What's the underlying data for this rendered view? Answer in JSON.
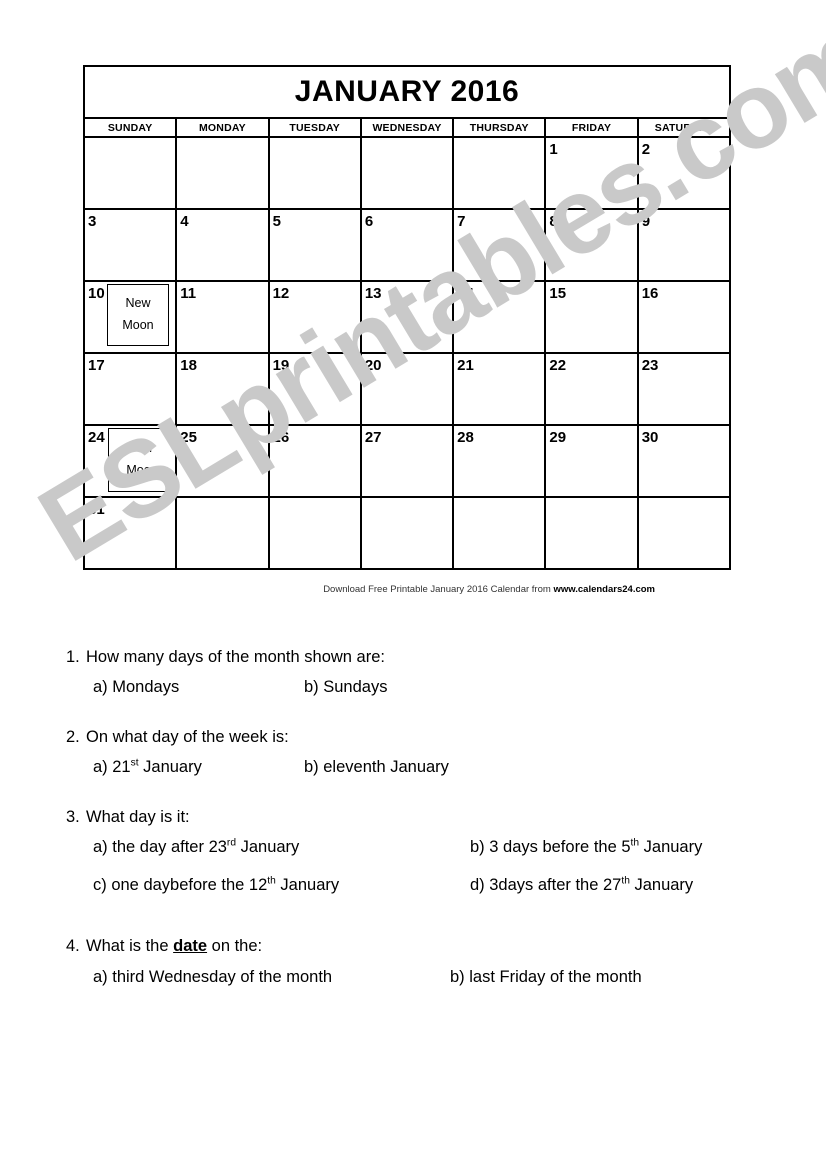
{
  "watermark": {
    "text": "ESLprintables.com"
  },
  "calendar": {
    "title": "JANUARY 2016",
    "weekdays": [
      "SUNDAY",
      "MONDAY",
      "TUESDAY",
      "WEDNESDAY",
      "THURSDAY",
      "FRIDAY",
      "SATURDAY"
    ],
    "weeks": [
      [
        "",
        "",
        "",
        "",
        "",
        "1",
        "2"
      ],
      [
        "3",
        "4",
        "5",
        "6",
        "7",
        "8",
        "9"
      ],
      [
        "10",
        "11",
        "12",
        "13",
        "14",
        "15",
        "16"
      ],
      [
        "17",
        "18",
        "19",
        "20",
        "21",
        "22",
        "23"
      ],
      [
        "24",
        "25",
        "26",
        "27",
        "28",
        "29",
        "30"
      ],
      [
        "31",
        "",
        "",
        "",
        "",
        "",
        ""
      ]
    ],
    "moon_new_line1": "New",
    "moon_new_line2": "Moon",
    "moon_full_line1": "Full",
    "moon_full_line2": "Moon",
    "footer_prefix": "Download  Free Printable January 2016 Calendar from",
    "footer_site": "www.calendars24.com"
  },
  "questions": {
    "q1": {
      "number": "1.",
      "stem": "How many days of the month shown are:",
      "a": "a)  Mondays",
      "b": "b) Sundays"
    },
    "q2": {
      "number": "2.",
      "stem": "On what day of the week is:",
      "a_pre": "a) 21",
      "a_sup": "st",
      "a_post": " January",
      "b": "b) eleventh January"
    },
    "q3": {
      "number": "3.",
      "stem": "What day is it:",
      "a_pre": "a) the day after 23",
      "a_sup": "rd",
      "a_post": " January",
      "b_pre": "b) 3 days before the 5",
      "b_sup": "th",
      "b_post": " January",
      "c_pre": "c) one daybefore the 12",
      "c_sup": "th",
      "c_post": " January",
      "d_pre": "d) 3days after the 27",
      "d_sup": "th",
      "d_post": " January"
    },
    "q4": {
      "number": "4.",
      "stem_pre": "What is the ",
      "stem_em": "date",
      "stem_post": " on the:",
      "a": "a) third Wednesday of the month",
      "b": "b) last Friday of the month"
    }
  }
}
